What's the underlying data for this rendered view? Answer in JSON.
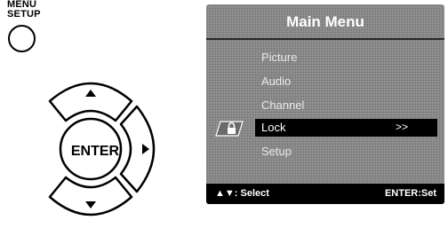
{
  "remote": {
    "menu_label_line1": "MENU",
    "menu_label_line2": "SETUP",
    "enter_label": "ENTER"
  },
  "tv_menu": {
    "title": "Main Menu",
    "items": [
      {
        "label": "Picture"
      },
      {
        "label": "Audio"
      },
      {
        "label": "Channel"
      },
      {
        "label": "Lock",
        "selected": true,
        "submenu_indicator": ">>"
      },
      {
        "label": "Setup"
      }
    ],
    "footer_left": "▲▼: Select",
    "footer_right": "ENTER:Set",
    "selected_icon": "lock-icon"
  },
  "colors": {
    "menu_background": "#8e8e8e",
    "selection": "#000000",
    "text": "#ffffff"
  }
}
